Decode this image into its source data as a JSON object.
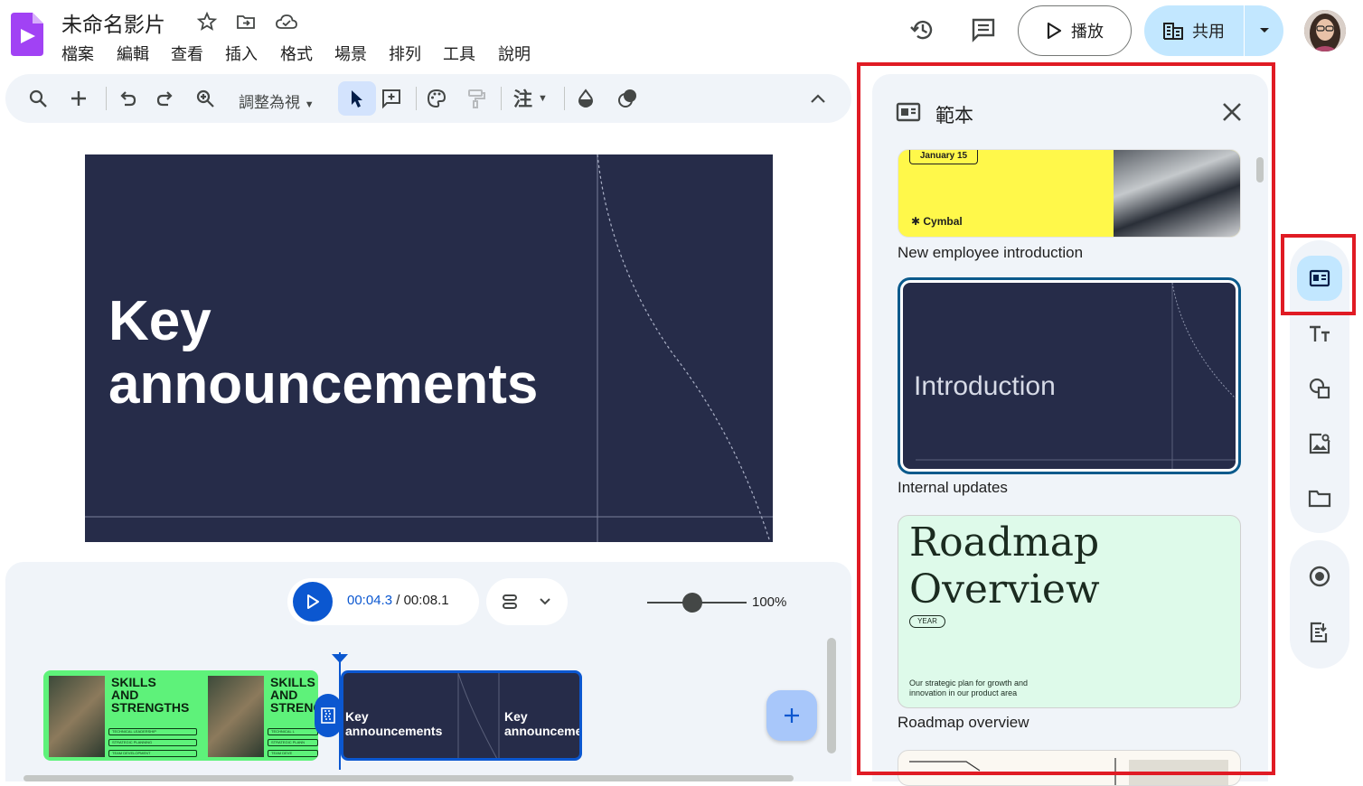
{
  "app": {
    "title": "未命名影片",
    "logo_icon": "vids-logo-icon",
    "title_icons": [
      "star-icon",
      "move-to-folder-icon",
      "cloud-saved-icon"
    ]
  },
  "menu": [
    "檔案",
    "編輯",
    "查看",
    "插入",
    "格式",
    "場景",
    "排列",
    "工具",
    "說明"
  ],
  "header": {
    "play_label": "播放",
    "share_label": "共用",
    "icons": [
      "version-history-icon",
      "comments-icon",
      "play-icon",
      "domain-icon",
      "chevron-down-icon",
      "avatar"
    ]
  },
  "toolbar": {
    "fit_label": "調整為視",
    "icons": [
      "search-icon",
      "add-icon",
      "undo-icon",
      "redo-icon",
      "zoom-icon",
      "select-pointer-icon",
      "add-comment-icon",
      "palette-icon",
      "paint-format-icon",
      "text-style-icon",
      "fill-icon",
      "shape-icon",
      "collapse-icon"
    ],
    "text_style_label": "注"
  },
  "slide": {
    "title_line1": "Key",
    "title_line2": "announcements",
    "background": "#262c49"
  },
  "player": {
    "current_time": "00:04.3",
    "separator": " / ",
    "total_time": "00:08.1",
    "zoom_label": "100%",
    "zoom_level": 0.45
  },
  "timeline": {
    "clip1": {
      "title_a": "SKILLS",
      "title_b": "AND",
      "title_c": "STRENGTHS",
      "title_c_cut": "STRENG",
      "line1": "TECHNICAL LEADERSHIP",
      "line2": "STRATEGIC PLANNING",
      "line3": "TEAM DEVELOPMENT",
      "line1_cut": "TECHNICAL L",
      "line2_cut": "STRATEGIC PLANN",
      "line3_cut": "TEAM DEVE"
    },
    "clip2": {
      "line1": "Key",
      "line2": "announcements",
      "line2_cut": "announceme"
    }
  },
  "panel": {
    "title": "範本",
    "templates": [
      {
        "name": "New employee introduction",
        "date": "January 15",
        "brand": "Cymbal"
      },
      {
        "name": "Internal updates",
        "preview_title": "Introduction"
      },
      {
        "name": "Roadmap overview",
        "title_line1": "Roadmap",
        "title_line2": "Overview",
        "badge": "YEAR",
        "desc": "Our strategic plan for growth and innovation in our product area"
      }
    ]
  },
  "rail": {
    "icons": [
      "templates-icon",
      "text-icon",
      "shapes-icon",
      "image-icon",
      "folder-icon",
      "record-icon",
      "script-icon"
    ]
  },
  "colors": {
    "accent": "#0b57d0",
    "highlight": "#e01b24",
    "share_bg": "#c2e7ff",
    "panel_bg": "#f0f4f9"
  }
}
